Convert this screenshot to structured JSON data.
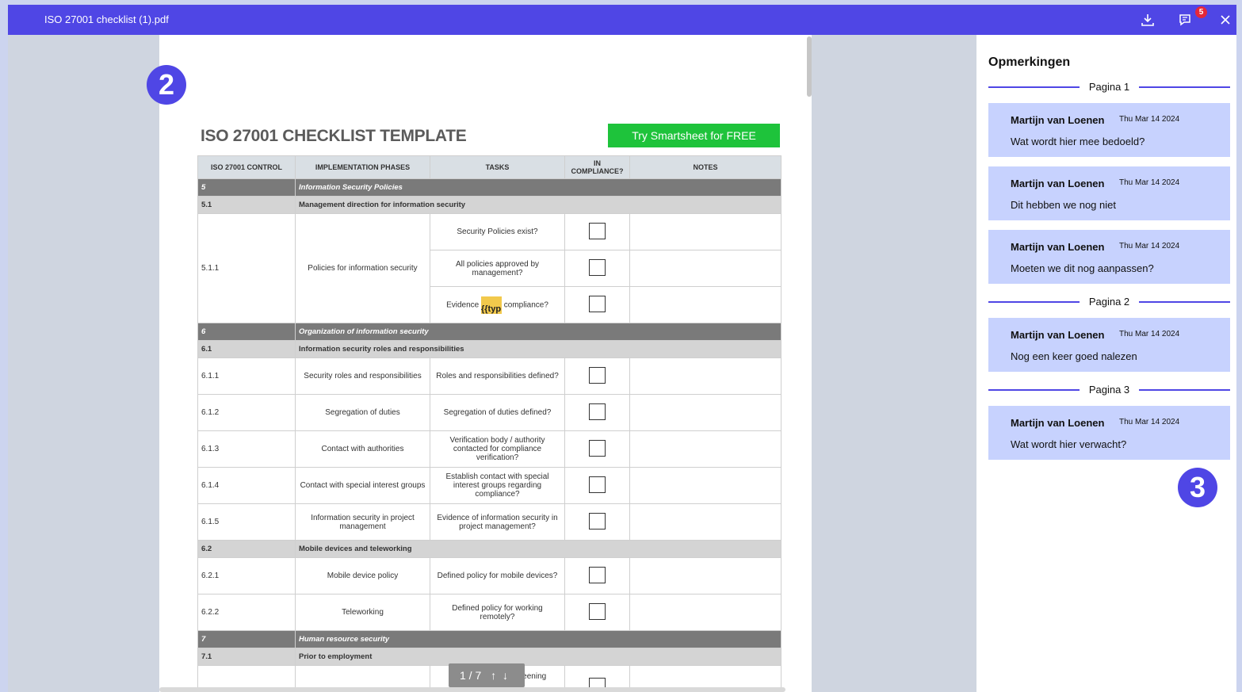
{
  "topbar": {
    "filename": "ISO 27001 checklist (1).pdf",
    "comment_count": "5"
  },
  "markers": {
    "viewer": "2",
    "comments": "3"
  },
  "document": {
    "title": "ISO 27001 CHECKLIST TEMPLATE",
    "cta": "Try Smartsheet for FREE",
    "headers": [
      "ISO 27001 CONTROL",
      "IMPLEMENTATION PHASES",
      "TASKS",
      "IN COMPLIANCE?",
      "NOTES"
    ],
    "sec5": {
      "num": "5",
      "label": "Information Security Policies"
    },
    "sub51": {
      "num": "5.1",
      "label": "Management direction for information security"
    },
    "ctrl511": {
      "num": "5.1.1",
      "phase": "Policies for information security"
    },
    "tasks511": [
      "Security Policies exist?",
      "All policies approved by management?",
      "Evidence",
      "compliance?"
    ],
    "broken_text": "{{typ",
    "sec6": {
      "num": "6",
      "label": "Organization of information security"
    },
    "sub61": {
      "num": "6.1",
      "label": "Information security roles and responsibilities"
    },
    "rows61": [
      {
        "num": "6.1.1",
        "phase": "Security roles and responsibilities",
        "task": "Roles and responsibilities defined?"
      },
      {
        "num": "6.1.2",
        "phase": "Segregation of duties",
        "task": "Segregation of duties defined?"
      },
      {
        "num": "6.1.3",
        "phase": "Contact with authorities",
        "task": "Verification body / authority contacted for compliance verification?"
      },
      {
        "num": "6.1.4",
        "phase": "Contact with special interest groups",
        "task": "Establish contact with special interest groups regarding compliance?"
      },
      {
        "num": "6.1.5",
        "phase": "Information security in project management",
        "task": "Evidence of information security in project management?"
      }
    ],
    "sub62": {
      "num": "6.2",
      "label": "Mobile devices and teleworking"
    },
    "rows62": [
      {
        "num": "6.2.1",
        "phase": "Mobile device policy",
        "task": "Defined policy for mobile devices?"
      },
      {
        "num": "6.2.2",
        "phase": "Teleworking",
        "task": "Defined policy for working remotely?"
      }
    ],
    "sec7": {
      "num": "7",
      "label": "Human resource security"
    },
    "sub71": {
      "num": "7.1",
      "label": "Prior to employment"
    },
    "partial_task": "Defined policy for screening"
  },
  "pager": {
    "text": "1 / 7"
  },
  "panel": {
    "title": "Opmerkingen",
    "groups": [
      {
        "label": "Pagina 1"
      },
      {
        "label": "Pagina 2"
      },
      {
        "label": "Pagina 3"
      }
    ],
    "comments": [
      {
        "author": "Martijn van Loenen",
        "date": "Thu Mar 14 2024",
        "text": "Wat wordt hier mee bedoeld?"
      },
      {
        "author": "Martijn van Loenen",
        "date": "Thu Mar 14 2024",
        "text": "Dit hebben we nog niet"
      },
      {
        "author": "Martijn van Loenen",
        "date": "Thu Mar 14 2024",
        "text": "Moeten we dit nog aanpassen?"
      },
      {
        "author": "Martijn van Loenen",
        "date": "Thu Mar 14 2024",
        "text": "Nog een keer goed nalezen"
      },
      {
        "author": "Martijn van Loenen",
        "date": "Thu Mar 14 2024",
        "text": "Wat wordt hier verwacht?"
      }
    ]
  }
}
